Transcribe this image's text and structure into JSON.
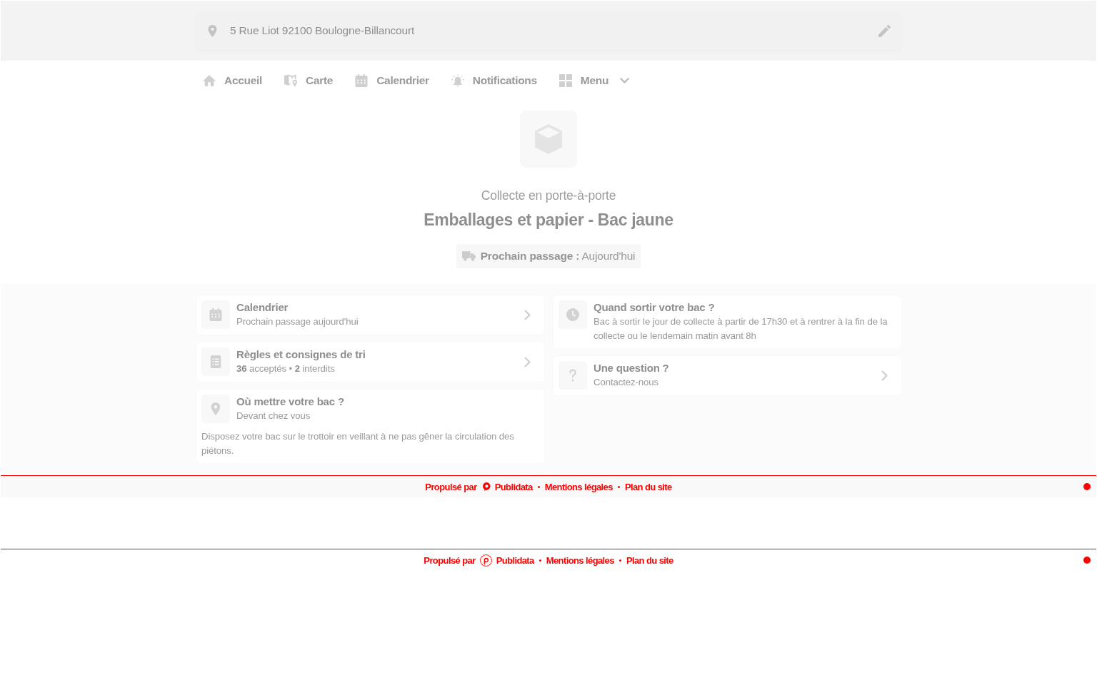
{
  "address_bar": {
    "address": "5 Rue Liot 92100 Boulogne-Billancourt"
  },
  "nav": {
    "items": [
      {
        "label": "Accueil",
        "kind": "link"
      },
      {
        "label": "Carte",
        "kind": "link"
      },
      {
        "label": "Calendrier",
        "kind": "link"
      },
      {
        "label": "Notifications",
        "kind": "link"
      },
      {
        "label": "Menu",
        "kind": "dropdown"
      }
    ]
  },
  "hero": {
    "category": "Collecte en porte-à-porte",
    "title": "Emballages et papier - Bac jaune",
    "next_pickup": "**Prochain passage :** Aujourd'hui"
  },
  "columns": [
    {
      "cards": [
        {
          "kind": "link",
          "title": "Calendrier",
          "subtitle": "Prochain passage aujourd'hui"
        },
        {
          "kind": "link",
          "title": "Règles et consignes de tri",
          "subtitle": "**36** acceptés • **2** interdits"
        },
        {
          "kind": "info",
          "title": "Où mettre votre bac ?",
          "subtitle": "Devant chez vous",
          "description": "Disposez votre bac sur le trottoir en veillant à ne pas gêner la circulation des piétons."
        }
      ]
    },
    {
      "cards": [
        {
          "kind": "info",
          "title": "Quand sortir votre bac ?",
          "subtitle": "Bac à sortir le jour de collecte à partir de 17h30 et à rentrer à la fin de la collecte ou le lendemain matin avant 8h"
        },
        {
          "kind": "link",
          "title": "Une question ?",
          "subtitle": "Contactez-nous"
        }
      ]
    }
  ],
  "footers": [
    {
      "kind": "band",
      "powered_by": "Propulsé par",
      "brand": "Publidata",
      "links": [
        "Mentions légales",
        "Plan du site"
      ]
    },
    {
      "kind": "plain",
      "powered_by": "Propulsé par",
      "brand": "Publidata",
      "links": [
        "Mentions légales",
        "Plan du site"
      ]
    }
  ]
}
